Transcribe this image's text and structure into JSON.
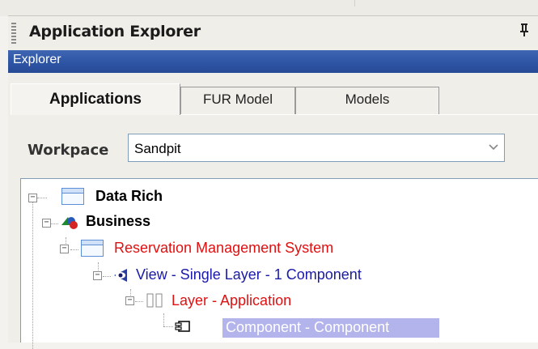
{
  "panel": {
    "title": "Application Explorer",
    "pin_glyph": "ᵖ"
  },
  "band": {
    "label": "Explorer"
  },
  "tabs": [
    {
      "label": "Applications",
      "active": true
    },
    {
      "label": "FUR Model",
      "active": false
    },
    {
      "label": "Models",
      "active": false
    }
  ],
  "workspace": {
    "label": "Workpace",
    "value": "Sandpit",
    "arrow_glyph": "▼"
  },
  "tree": {
    "nodes": [
      {
        "label": "Data Rich",
        "icon": "window-icon",
        "expander": "−",
        "color": "#000000",
        "bold": true
      },
      {
        "label": "Business",
        "icon": "shapes-icon",
        "expander": "−",
        "color": "#000000",
        "bold": true
      },
      {
        "label": "Reservation Management System",
        "icon": "window-icon",
        "expander": "−",
        "color": "#e01010"
      },
      {
        "label": "View - Single  Layer - 1 Component",
        "icon": "view-icon",
        "expander": "−",
        "color": "#1a1aa8"
      },
      {
        "label": "Layer - Application",
        "icon": "layer-icon",
        "expander": "−",
        "color": "#e01010"
      },
      {
        "label": "Component - Component",
        "icon": "component-icon",
        "selected": true,
        "color": "#ffffff"
      }
    ]
  },
  "colors": {
    "band": "#2d53a3",
    "selection": "#b4b4ec",
    "red_text": "#e01010",
    "blue_text": "#1a1aa8"
  }
}
